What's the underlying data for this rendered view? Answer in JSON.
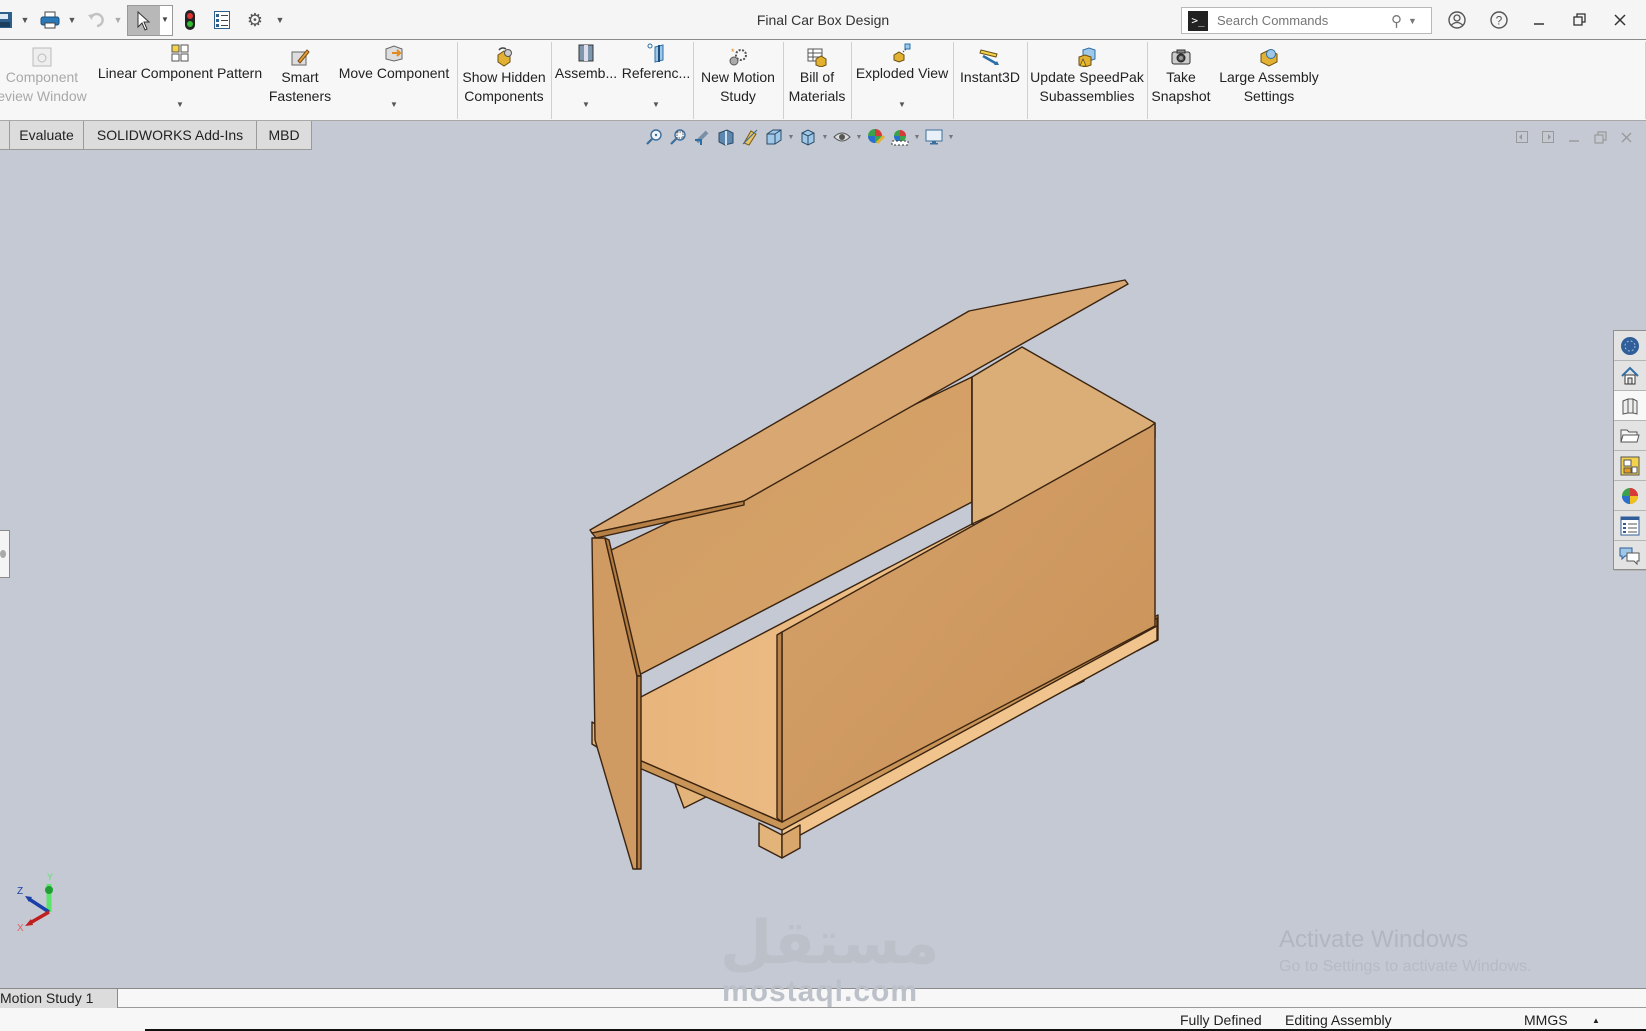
{
  "window": {
    "title": "Final Car Box Design",
    "search_placeholder": "Search Commands"
  },
  "quick_access": [
    {
      "name": "save",
      "icon": "save-icon"
    },
    {
      "name": "print",
      "icon": "printer-icon"
    },
    {
      "name": "undo",
      "icon": "undo-icon"
    },
    {
      "name": "select",
      "icon": "cursor-icon"
    },
    {
      "name": "rebuild",
      "icon": "traffic-light-icon"
    },
    {
      "name": "file-properties",
      "icon": "list-icon"
    },
    {
      "name": "options",
      "icon": "gear-icon"
    }
  ],
  "ribbon": {
    "items": [
      {
        "label1": "Component",
        "label2": "eview Window",
        "icon": "preview-window-icon",
        "disabled": true
      },
      {
        "label1": "Linear Component Pattern",
        "label2": "",
        "icon": "pattern-icon",
        "dropdown": true
      },
      {
        "label1": "Smart",
        "label2": "Fasteners",
        "icon": "fastener-icon"
      },
      {
        "label1": "Move Component",
        "label2": "",
        "icon": "move-component-icon",
        "dropdown": true
      },
      {
        "label1": "Show Hidden",
        "label2": "Components",
        "icon": "show-hidden-icon"
      },
      {
        "label1": "Assemb...",
        "label2": "",
        "icon": "assembly-features-icon",
        "dropdown": true
      },
      {
        "label1": "Referenc...",
        "label2": "",
        "icon": "reference-geometry-icon",
        "dropdown": true
      },
      {
        "label1": "New Motion",
        "label2": "Study",
        "icon": "motion-study-icon"
      },
      {
        "label1": "Bill of",
        "label2": "Materials",
        "icon": "bom-icon"
      },
      {
        "label1": "Exploded View",
        "label2": "",
        "icon": "exploded-view-icon",
        "dropdown": true
      },
      {
        "label1": "Instant3D",
        "label2": "",
        "icon": "instant3d-icon"
      },
      {
        "label1": "Update SpeedPak",
        "label2": "Subassemblies",
        "icon": "speedpak-icon"
      },
      {
        "label1": "Take",
        "label2": "Snapshot",
        "icon": "camera-icon"
      },
      {
        "label1": "Large Assembly",
        "label2": "Settings",
        "icon": "large-assembly-icon"
      }
    ]
  },
  "tabs": [
    "Evaluate",
    "SOLIDWORKS Add-Ins",
    "MBD"
  ],
  "heads_up_toolbar": [
    "zoom-to-fit",
    "zoom-to-area",
    "previous-view",
    "section-view",
    "dynamic-annotation",
    "view-orientation",
    "display-style",
    "hide-show-items",
    "edit-appearance",
    "apply-scene",
    "view-settings"
  ],
  "task_pane": [
    "solidworks-resources",
    "home",
    "design-library",
    "file-explorer",
    "view-palette",
    "appearances",
    "custom-properties",
    "forum"
  ],
  "model": {
    "name": "Final Car Box Design",
    "wood_color": "#dca66b"
  },
  "triad": {
    "x": "X",
    "y": "Y",
    "z": "Z"
  },
  "overlay": {
    "activate_title": "Activate Windows",
    "activate_sub": "Go to Settings to activate Windows.",
    "brand_ar": "مستقل",
    "brand_en": "mostaql.com"
  },
  "motion_tab": "Motion Study 1",
  "status": {
    "definition": "Fully Defined",
    "mode": "Editing Assembly",
    "units": "MMGS",
    "units_arrow": "▲"
  }
}
